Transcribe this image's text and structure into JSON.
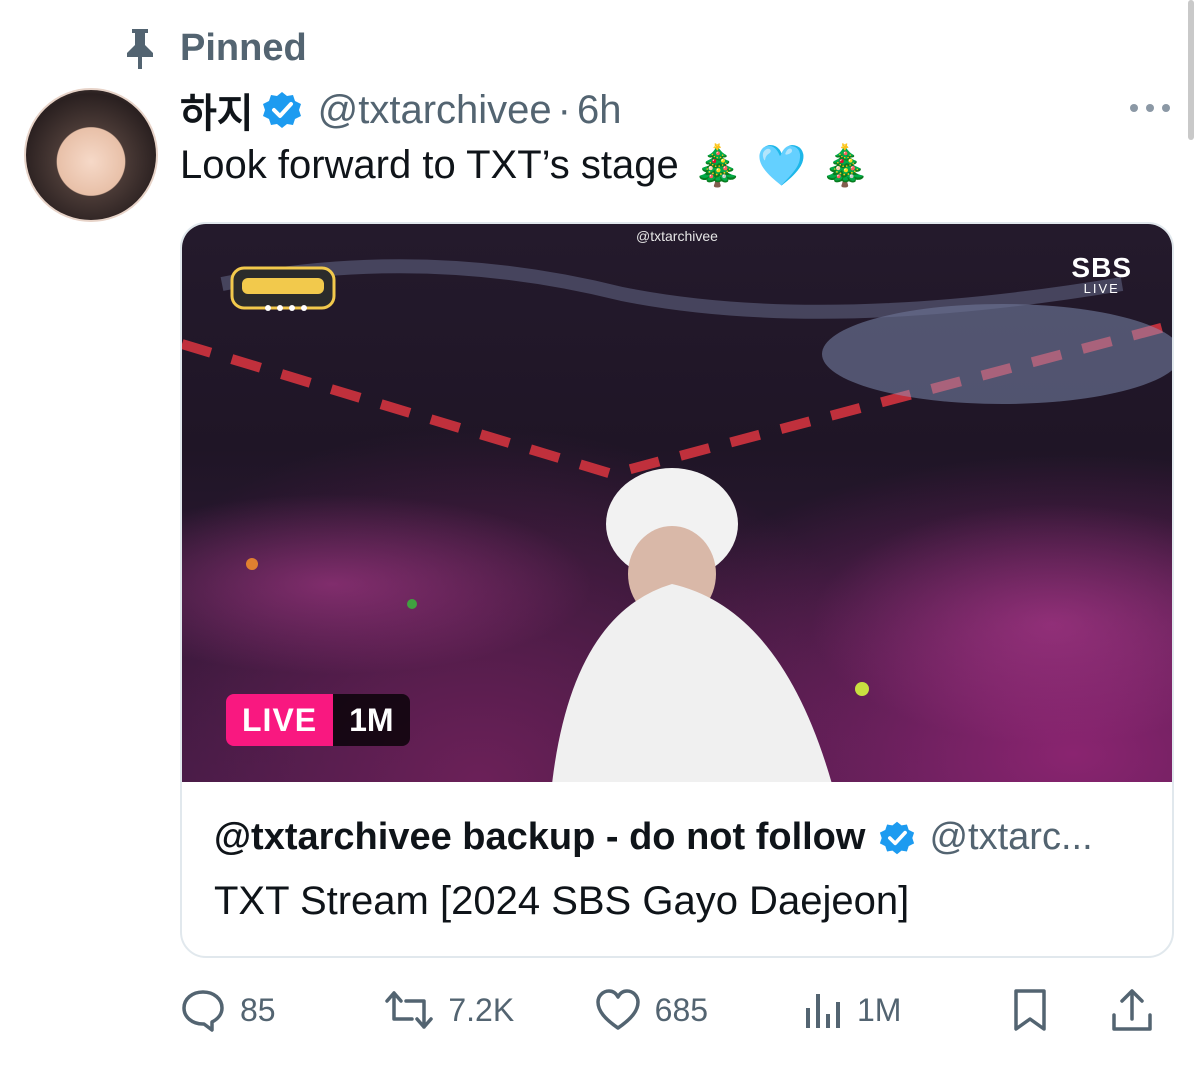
{
  "pinned": {
    "label": "Pinned"
  },
  "author": {
    "display_name": "하지",
    "handle": "@txtarchivee",
    "separator": "·",
    "time": "6h"
  },
  "tweet": {
    "text": "Look forward to TXT’s stage",
    "emojis": [
      "🎄",
      "🩵",
      "🎄"
    ]
  },
  "media": {
    "watermark": "@txtarchivee",
    "broadcaster_right": "SBS",
    "broadcaster_right_sub": "LIVE",
    "live_label": "LIVE",
    "viewers": "1M"
  },
  "card": {
    "source_name": "@txtarchivee backup - do not follow",
    "source_handle": "@txtarc...",
    "title": "TXT Stream [2024 SBS Gayo Daejeon]"
  },
  "actions": {
    "replies": "85",
    "reposts": "7.2K",
    "likes": "685",
    "views": "1M"
  },
  "colors": {
    "verified": "#1d9bf0",
    "live": "#f91880",
    "secondary_text": "#536471"
  }
}
